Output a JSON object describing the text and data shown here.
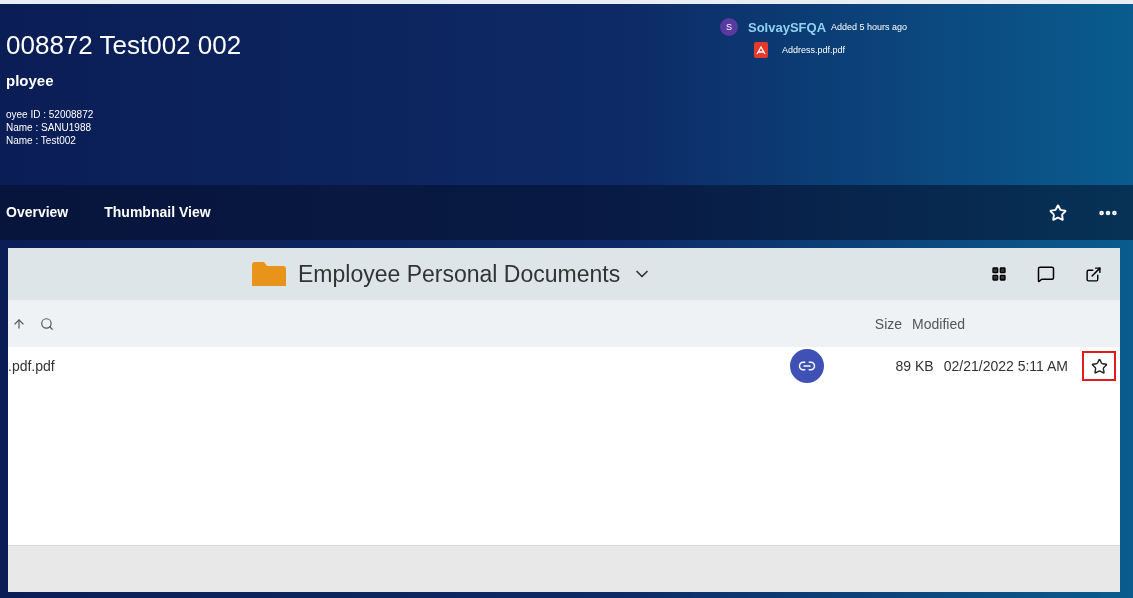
{
  "header": {
    "title": "008872 Test002 002",
    "subtitle": "ployee",
    "details": [
      "oyee ID : 52008872",
      "Name : SANU1988",
      "Name : Test002"
    ]
  },
  "activity": {
    "avatar": "S",
    "user": "SolvaySFQA",
    "time": "Added 5 hours ago",
    "file": "Address.pdf.pdf"
  },
  "nav": {
    "tabs": [
      {
        "label": "Overview",
        "selected": false
      },
      {
        "label": "Thumbnail View",
        "selected": false
      }
    ]
  },
  "folder": {
    "title": "Employee Personal Documents"
  },
  "table": {
    "columns": [
      {
        "label": "Size"
      },
      {
        "label": "Modified"
      }
    ],
    "rows": [
      {
        "name": ".pdf.pdf",
        "shared": true,
        "size": "89 KB",
        "modified": "02/21/2022 5:11 AM",
        "star_highlighted": true
      }
    ]
  }
}
